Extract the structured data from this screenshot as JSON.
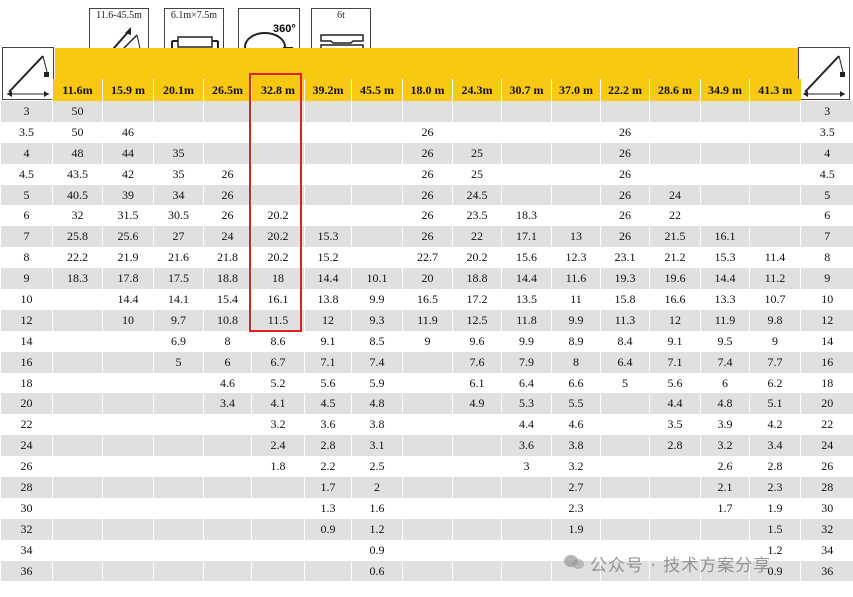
{
  "icons": {
    "boom_length": "11.6-45.5m",
    "outrigger_span": "6.1m×7.5m",
    "slew_angle": "360°",
    "counterweight": "6t"
  },
  "columns": [
    "11.6m",
    "15.9 m",
    "20.1m",
    "26.5m",
    "32.8 m",
    "39.2m",
    "45.5 m",
    "18.0 m",
    "24.3m",
    "30.7 m",
    "37.0 m",
    "22.2 m",
    "28.6 m",
    "34.9 m",
    "41.3 m"
  ],
  "highlighted_column": "32.8 m",
  "rows": [
    {
      "r": "3",
      "v": [
        "50",
        "",
        "",
        "",
        "",
        "",
        "",
        "",
        "",
        "",
        "",
        "",
        "",
        "",
        ""
      ]
    },
    {
      "r": "3.5",
      "v": [
        "50",
        "46",
        "",
        "",
        "",
        "",
        "",
        "26",
        "",
        "",
        "",
        "26",
        "",
        "",
        ""
      ]
    },
    {
      "r": "4",
      "v": [
        "48",
        "44",
        "35",
        "",
        "",
        "",
        "",
        "26",
        "25",
        "",
        "",
        "26",
        "",
        "",
        ""
      ]
    },
    {
      "r": "4.5",
      "v": [
        "43.5",
        "42",
        "35",
        "26",
        "",
        "",
        "",
        "26",
        "25",
        "",
        "",
        "26",
        "",
        "",
        ""
      ]
    },
    {
      "r": "5",
      "v": [
        "40.5",
        "39",
        "34",
        "26",
        "",
        "",
        "",
        "26",
        "24.5",
        "",
        "",
        "26",
        "24",
        "",
        ""
      ]
    },
    {
      "r": "6",
      "v": [
        "32",
        "31.5",
        "30.5",
        "26",
        "20.2",
        "",
        "",
        "26",
        "23.5",
        "18.3",
        "",
        "26",
        "22",
        "",
        ""
      ]
    },
    {
      "r": "7",
      "v": [
        "25.8",
        "25.6",
        "27",
        "24",
        "20.2",
        "15.3",
        "",
        "26",
        "22",
        "17.1",
        "13",
        "26",
        "21.5",
        "16.1",
        ""
      ]
    },
    {
      "r": "8",
      "v": [
        "22.2",
        "21.9",
        "21.6",
        "21.8",
        "20.2",
        "15.2",
        "",
        "22.7",
        "20.2",
        "15.6",
        "12.3",
        "23.1",
        "21.2",
        "15.3",
        "11.4"
      ]
    },
    {
      "r": "9",
      "v": [
        "18.3",
        "17.8",
        "17.5",
        "18.8",
        "18",
        "14.4",
        "10.1",
        "20",
        "18.8",
        "14.4",
        "11.6",
        "19.3",
        "19.6",
        "14.4",
        "11.2"
      ]
    },
    {
      "r": "10",
      "v": [
        "",
        "14.4",
        "14.1",
        "15.4",
        "16.1",
        "13.8",
        "9.9",
        "16.5",
        "17.2",
        "13.5",
        "11",
        "15.8",
        "16.6",
        "13.3",
        "10.7"
      ]
    },
    {
      "r": "12",
      "v": [
        "",
        "10",
        "9.7",
        "10.8",
        "11.5",
        "12",
        "9.3",
        "11.9",
        "12.5",
        "11.8",
        "9.9",
        "11.3",
        "12",
        "11.9",
        "9.8"
      ]
    },
    {
      "r": "14",
      "v": [
        "",
        "",
        "6.9",
        "8",
        "8.6",
        "9.1",
        "8.5",
        "9",
        "9.6",
        "9.9",
        "8.9",
        "8.4",
        "9.1",
        "9.5",
        "9"
      ]
    },
    {
      "r": "16",
      "v": [
        "",
        "",
        "5",
        "6",
        "6.7",
        "7.1",
        "7.4",
        "",
        "7.6",
        "7.9",
        "8",
        "6.4",
        "7.1",
        "7.4",
        "7.7"
      ]
    },
    {
      "r": "18",
      "v": [
        "",
        "",
        "",
        "4.6",
        "5.2",
        "5.6",
        "5.9",
        "",
        "6.1",
        "6.4",
        "6.6",
        "5",
        "5.6",
        "6",
        "6.2"
      ]
    },
    {
      "r": "20",
      "v": [
        "",
        "",
        "",
        "3.4",
        "4.1",
        "4.5",
        "4.8",
        "",
        "4.9",
        "5.3",
        "5.5",
        "",
        "4.4",
        "4.8",
        "5.1"
      ]
    },
    {
      "r": "22",
      "v": [
        "",
        "",
        "",
        "",
        "3.2",
        "3.6",
        "3.8",
        "",
        "",
        "4.4",
        "4.6",
        "",
        "3.5",
        "3.9",
        "4.2"
      ]
    },
    {
      "r": "24",
      "v": [
        "",
        "",
        "",
        "",
        "2.4",
        "2.8",
        "3.1",
        "",
        "",
        "3.6",
        "3.8",
        "",
        "2.8",
        "3.2",
        "3.4"
      ]
    },
    {
      "r": "26",
      "v": [
        "",
        "",
        "",
        "",
        "1.8",
        "2.2",
        "2.5",
        "",
        "",
        "3",
        "3.2",
        "",
        "",
        "2.6",
        "2.8"
      ]
    },
    {
      "r": "28",
      "v": [
        "",
        "",
        "",
        "",
        "",
        "1.7",
        "2",
        "",
        "",
        "",
        "2.7",
        "",
        "",
        "2.1",
        "2.3"
      ]
    },
    {
      "r": "30",
      "v": [
        "",
        "",
        "",
        "",
        "",
        "1.3",
        "1.6",
        "",
        "",
        "",
        "2.3",
        "",
        "",
        "1.7",
        "1.9"
      ]
    },
    {
      "r": "32",
      "v": [
        "",
        "",
        "",
        "",
        "",
        "0.9",
        "1.2",
        "",
        "",
        "",
        "1.9",
        "",
        "",
        "",
        "1.5"
      ]
    },
    {
      "r": "34",
      "v": [
        "",
        "",
        "",
        "",
        "",
        "",
        "0.9",
        "",
        "",
        "",
        "",
        "",
        "",
        "",
        "1.2"
      ]
    },
    {
      "r": "36",
      "v": [
        "",
        "",
        "",
        "",
        "",
        "",
        "0.6",
        "",
        "",
        "",
        "",
        "",
        "",
        "",
        "0.9"
      ]
    }
  ],
  "watermark": "公众号 · 技术方案分享",
  "colors": {
    "header_band": "#f9c812",
    "highlight": "#e02020",
    "row_shade": "#e0e0e0"
  }
}
